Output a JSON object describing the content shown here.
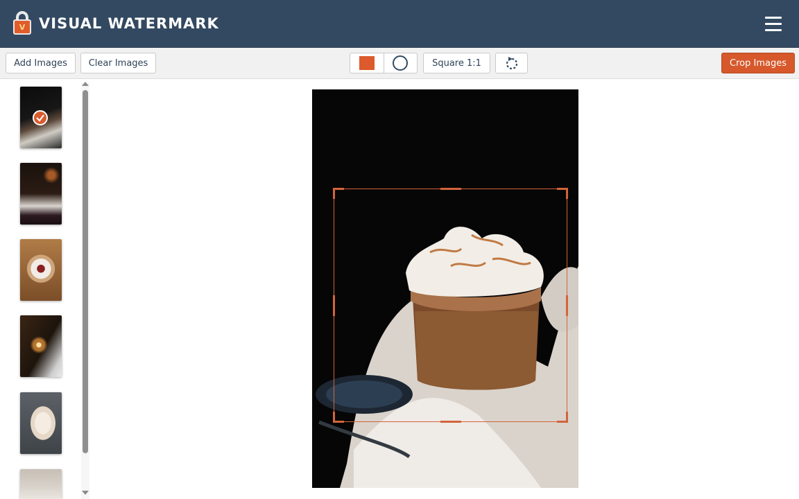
{
  "app": {
    "title": "VISUAL WATERMARK"
  },
  "header": {
    "menu_icon": "hamburger-menu-icon"
  },
  "toolbar": {
    "add_images": "Add Images",
    "clear_images": "Clear Images",
    "shape_square_icon": "square-shape-icon",
    "shape_circle_icon": "circle-shape-icon",
    "aspect_ratio": "Square 1:1",
    "rotate_icon": "rotate-icon",
    "crop_images": "Crop Images"
  },
  "sidebar": {
    "thumbnails": [
      {
        "description": "meringue cupcake",
        "selected": true
      },
      {
        "description": "layer cake slice",
        "selected": false
      },
      {
        "description": "plated dessert",
        "selected": false
      },
      {
        "description": "candle light",
        "selected": false
      },
      {
        "description": "dessert plate",
        "selected": false
      },
      {
        "description": "table setting",
        "selected": false
      }
    ]
  },
  "colors": {
    "header_bg": "#334961",
    "accent": "#d6582b",
    "toolbar_bg": "#f1f1f1"
  }
}
